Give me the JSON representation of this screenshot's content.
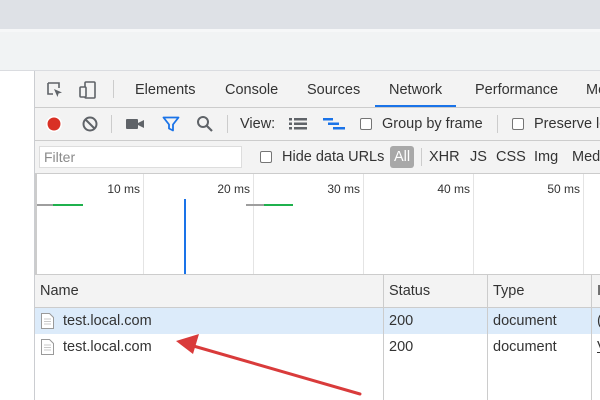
{
  "devtools": {
    "tabs": [
      "Elements",
      "Console",
      "Sources",
      "Network",
      "Performance",
      "Memory"
    ],
    "active_tab": "Network",
    "toolbar": {
      "view_label": "View:",
      "group_by_frame": "Group by frame",
      "preserve_log": "Preserve log"
    },
    "filter_bar": {
      "placeholder": "Filter",
      "hide_data_urls": "Hide data URLs",
      "types": [
        "All",
        "XHR",
        "JS",
        "CSS",
        "Img",
        "Media"
      ],
      "active_type": "All"
    },
    "timeline": {
      "ticks": [
        "10 ms",
        "20 ms",
        "30 ms",
        "40 ms",
        "50 ms"
      ]
    },
    "table": {
      "columns": [
        "Name",
        "Status",
        "Type",
        "I"
      ],
      "rows": [
        {
          "name": "test.local.com",
          "status": "200",
          "type": "document",
          "initiator": "(",
          "selected": true
        },
        {
          "name": "test.local.com",
          "status": "200",
          "type": "document",
          "initiator": "V",
          "selected": false
        }
      ]
    }
  },
  "colors": {
    "record": "#d93025",
    "accent_blue": "#1a73e8",
    "selected_row": "#dcebfa",
    "arrow": "#d93b3b",
    "timing_green": "#1fb14d"
  }
}
